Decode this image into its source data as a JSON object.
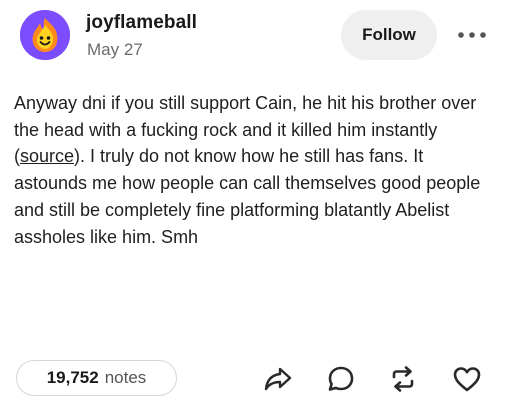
{
  "post": {
    "username": "joyflameball",
    "date": "May 27",
    "follow_label": "Follow",
    "more_icon": "more-horizontal-icon",
    "body_before_link": "Anyway dni if you still support Cain, he hit his brother over the head with a fucking rock and it killed him instantly (",
    "link_text": "source",
    "body_after_link": "). I truly do not know how he still has fans. It astounds me how people can call themselves good people and still be completely fine platforming blatantly Abelist assholes like him. Smh"
  },
  "footer": {
    "notes_count": "19,752",
    "notes_label": "notes",
    "actions": [
      "share-icon",
      "reply-icon",
      "reblog-icon",
      "like-icon"
    ]
  },
  "colors": {
    "avatar_bg": "#7b4dff",
    "flame_outer": "#ff8a1c",
    "flame_inner": "#ffd21f",
    "text": "#1f1f1f",
    "muted": "#6b6b6b",
    "button_bg": "#efefef"
  }
}
